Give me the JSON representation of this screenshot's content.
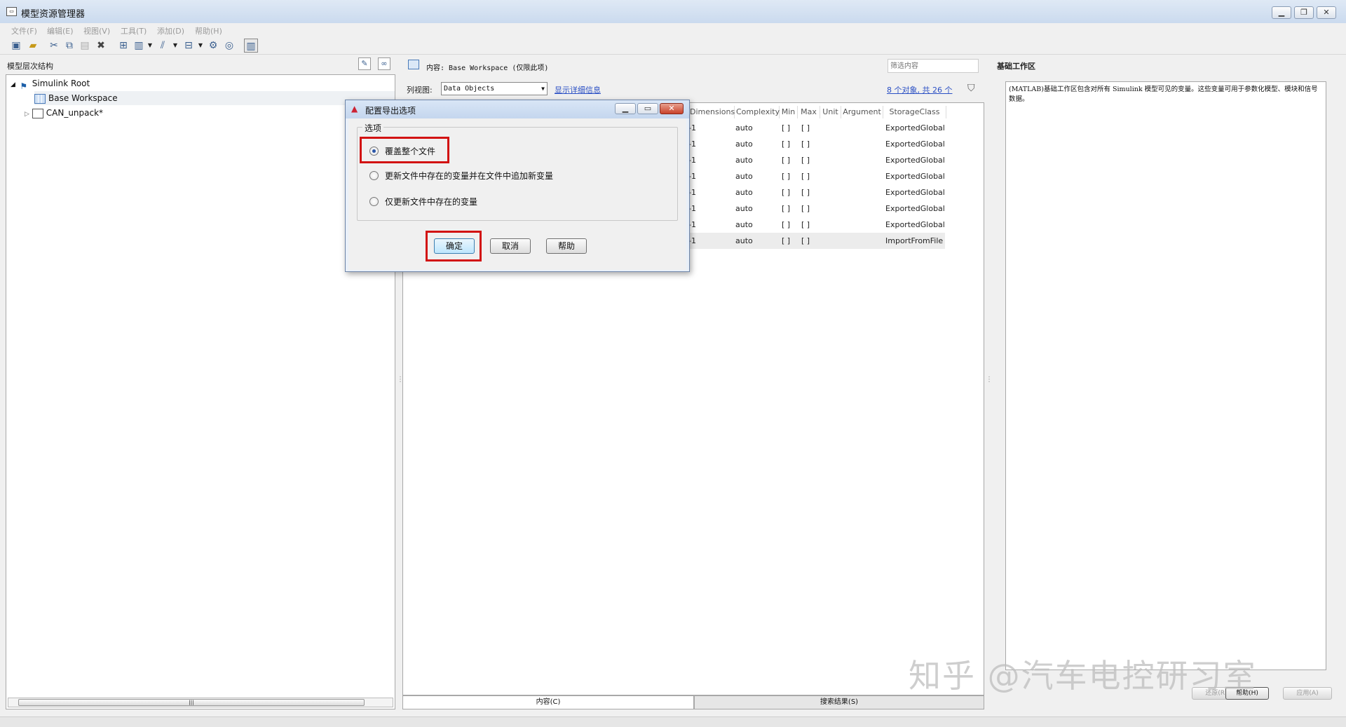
{
  "window": {
    "title": "模型资源管理器"
  },
  "menu": [
    "文件(F)",
    "编辑(E)",
    "视图(V)",
    "工具(T)",
    "添加(D)",
    "帮助(H)"
  ],
  "left_panel": {
    "title": "模型层次结构",
    "tree": [
      {
        "label": "Simulink Root"
      },
      {
        "label": "Base Workspace"
      },
      {
        "label": "CAN_unpack*"
      }
    ]
  },
  "content": {
    "header": "内容: Base Workspace (仅限此项)",
    "filter_placeholder": "筛选内容",
    "view_label": "列视图:",
    "view_value": "Data Objects",
    "details_link": "显示详细信息",
    "count_link": "8 个对象, 共 26 个",
    "columns": [
      "Dimensions",
      "Complexity",
      "Min",
      "Max",
      "Unit",
      "Argument",
      "StorageClass"
    ],
    "rows": [
      {
        "dim": "-1",
        "cx": "auto",
        "min": "[ ]",
        "max": "[ ]",
        "sc": "ExportedGlobal"
      },
      {
        "dim": "-1",
        "cx": "auto",
        "min": "[ ]",
        "max": "[ ]",
        "sc": "ExportedGlobal"
      },
      {
        "dim": "-1",
        "cx": "auto",
        "min": "[ ]",
        "max": "[ ]",
        "sc": "ExportedGlobal"
      },
      {
        "dim": "-1",
        "cx": "auto",
        "min": "[ ]",
        "max": "[ ]",
        "sc": "ExportedGlobal"
      },
      {
        "dim": "-1",
        "cx": "auto",
        "min": "[ ]",
        "max": "[ ]",
        "sc": "ExportedGlobal"
      },
      {
        "dim": "-1",
        "cx": "auto",
        "min": "[ ]",
        "max": "[ ]",
        "sc": "ExportedGlobal"
      },
      {
        "dim": "-1",
        "cx": "auto",
        "min": "[ ]",
        "max": "[ ]",
        "sc": "ExportedGlobal"
      },
      {
        "dim": "-1",
        "cx": "auto",
        "min": "[ ]",
        "max": "[ ]",
        "sc": "ImportFromFile"
      }
    ],
    "tabs": [
      "内容(C)",
      "搜索结果(S)"
    ]
  },
  "right_panel": {
    "title": "基础工作区",
    "description": "(MATLAB)基础工作区包含对所有 Simulink 模型可见的变量。这些变量可用于参数化模型、模块和信号数据。",
    "buttons": [
      "还原(R)",
      "帮助(H)",
      "应用(A)"
    ]
  },
  "dialog": {
    "title": "配置导出选项",
    "group_label": "选项",
    "options": [
      "覆盖整个文件",
      "更新文件中存在的变量并在文件中追加新变量",
      "仅更新文件中存在的变量"
    ],
    "selected": 0,
    "buttons": [
      "确定",
      "取消",
      "帮助"
    ]
  },
  "watermark": "知乎 @汽车电控研习室"
}
